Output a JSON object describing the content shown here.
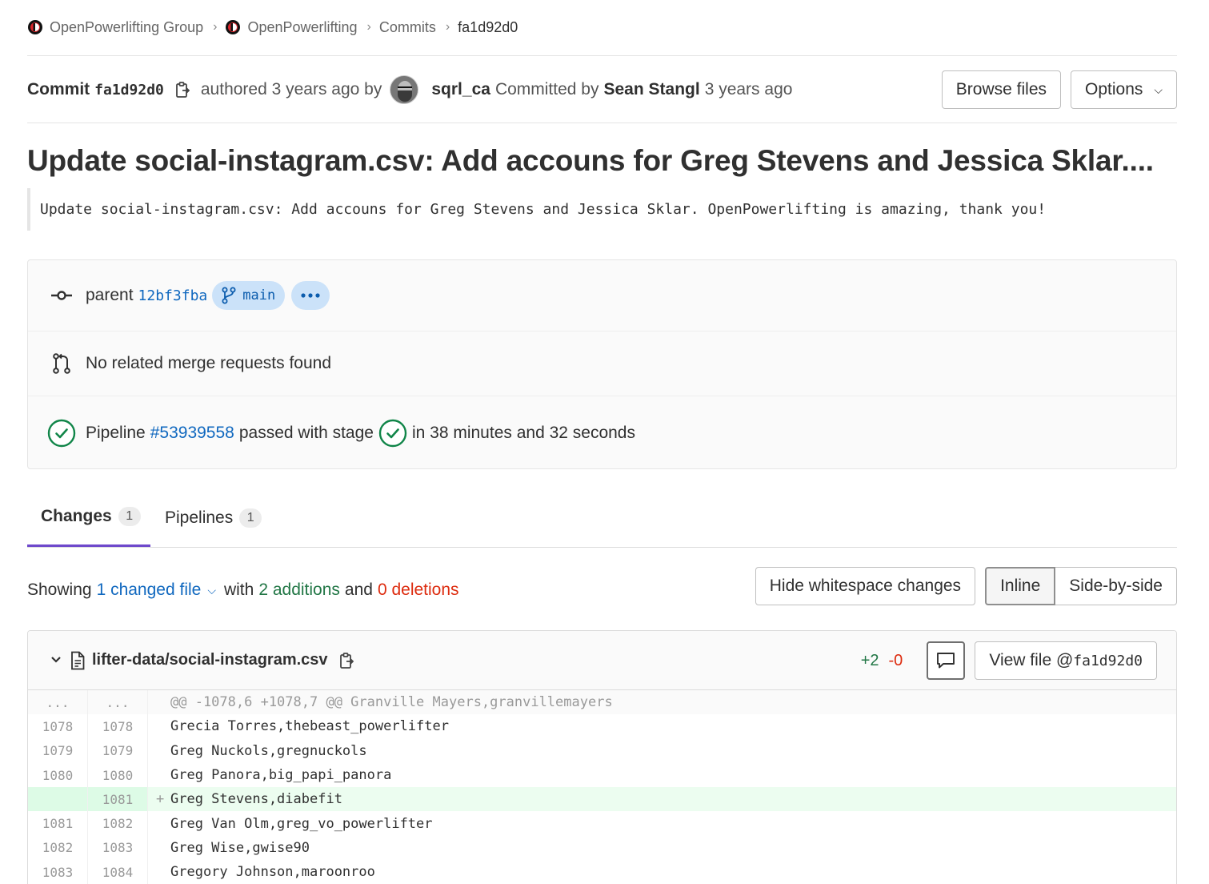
{
  "breadcrumb": {
    "items": [
      "OpenPowerlifting Group",
      "OpenPowerlifting",
      "Commits",
      "fa1d92d0"
    ]
  },
  "commit": {
    "label": "Commit",
    "sha": "fa1d92d0",
    "authored_text": "authored 3 years ago by",
    "author": "sqrl_ca",
    "committed_by_text": "Committed by",
    "committer": "Sean Stangl",
    "committed_ago": "3 years ago",
    "browse_files": "Browse files",
    "options": "Options",
    "title": "Update social-instagram.csv: Add accouns for Greg Stevens and Jessica Sklar....",
    "description": "Update social-instagram.csv: Add accouns for Greg Stevens and Jessica Sklar. OpenPowerlifting is amazing, thank you!"
  },
  "info": {
    "parent_label": "parent",
    "parent_sha": "12bf3fba",
    "branch": "main",
    "no_mr": "No related merge requests found",
    "pipeline_label": "Pipeline",
    "pipeline_id": "#53939558",
    "pipeline_status": "passed with stage",
    "pipeline_duration": "in 38 minutes and 32 seconds"
  },
  "tabs": [
    {
      "label": "Changes",
      "count": "1"
    },
    {
      "label": "Pipelines",
      "count": "1"
    }
  ],
  "summary": {
    "showing": "Showing",
    "changed_files": "1 changed file",
    "with": "with",
    "additions": "2 additions",
    "and": "and",
    "deletions": "0 deletions",
    "hide_whitespace": "Hide whitespace changes",
    "inline": "Inline",
    "side_by_side": "Side-by-side"
  },
  "file": {
    "path": "lifter-data/social-instagram.csv",
    "added": "+2",
    "removed": "-0",
    "view_file_label": "View file @",
    "view_file_sha": "fa1d92d0"
  },
  "diff": {
    "hunk_old": "...",
    "hunk_new": "...",
    "hunk_header": "@@ -1078,6 +1078,7 @@ Granville Mayers,granvillemayers",
    "lines": [
      {
        "old": "1078",
        "new": "1078",
        "sign": " ",
        "text": "Grecia Torres,thebeast_powerlifter"
      },
      {
        "old": "1079",
        "new": "1079",
        "sign": " ",
        "text": "Greg Nuckols,gregnuckols"
      },
      {
        "old": "1080",
        "new": "1080",
        "sign": " ",
        "text": "Greg Panora,big_papi_panora"
      },
      {
        "old": "",
        "new": "1081",
        "sign": "+",
        "text": "Greg Stevens,diabefit"
      },
      {
        "old": "1081",
        "new": "1082",
        "sign": " ",
        "text": "Greg Van Olm,greg_vo_powerlifter"
      },
      {
        "old": "1082",
        "new": "1083",
        "sign": " ",
        "text": "Greg Wise,gwise90"
      },
      {
        "old": "1083",
        "new": "1084",
        "sign": " ",
        "text": "Gregory Johnson,maroonroo"
      }
    ]
  },
  "colors": {
    "link": "#1068bf",
    "success": "#108548",
    "addition": "#217645",
    "deletion": "#dd2b0e",
    "tab_active": "#6e49cb",
    "added_line_bg": "#ecfdf0"
  }
}
